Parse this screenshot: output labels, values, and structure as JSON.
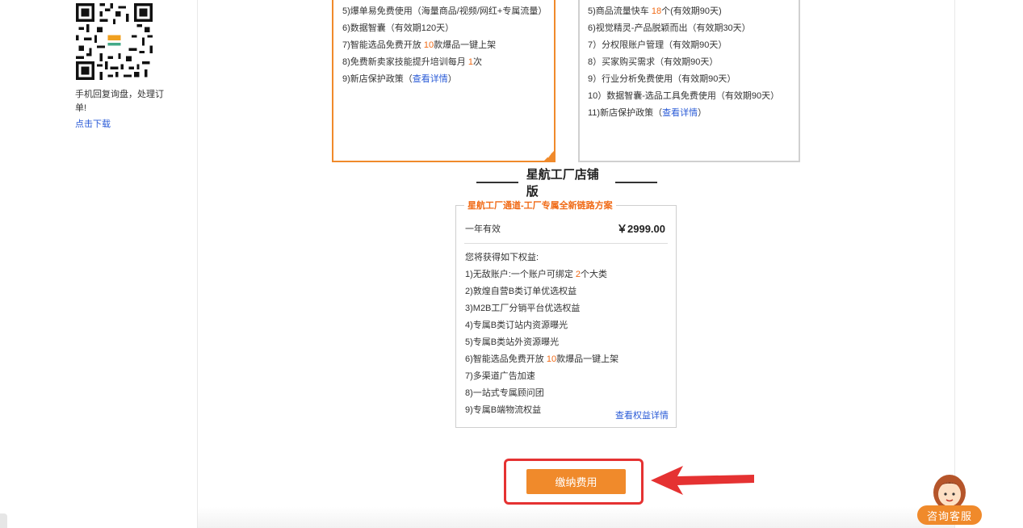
{
  "sidebar": {
    "qr_note": "手机回复询盘，处理订单!",
    "download_link": "点击下载",
    "qr_icon": "qr-code-icon"
  },
  "card_a": {
    "items": [
      {
        "pre": "5)爆单易免费使用（海量商品/视频/网红+专属流量）",
        "hl": "",
        "post": ""
      },
      {
        "pre": "6)数据智囊（有效期120天）",
        "hl": "",
        "post": ""
      },
      {
        "pre": "7)智能选品免费开放 ",
        "hl": "10",
        "post": "款爆品一键上架"
      },
      {
        "pre": "8)免费新卖家技能提升培训每月 ",
        "hl": "1",
        "post": "次"
      },
      {
        "pre": "9)新店保护政策（",
        "link": "查看详情",
        "post": "）"
      }
    ]
  },
  "card_b": {
    "items": [
      {
        "pre": "5)商品流量快车 ",
        "hl": "18",
        "post": "个(有效期90天)"
      },
      {
        "pre": "6)视觉精灵-产品脱颖而出（有效期30天）",
        "hl": "",
        "post": ""
      },
      {
        "pre": "7）分权限账户管理（有效期90天）",
        "hl": "",
        "post": ""
      },
      {
        "pre": "8）买家购买需求（有效期90天）",
        "hl": "",
        "post": ""
      },
      {
        "pre": "9）行业分析免费使用（有效期90天）",
        "hl": "",
        "post": ""
      },
      {
        "pre": "10）数据智囊-选品工具免费使用（有效期90天）",
        "hl": "",
        "post": ""
      },
      {
        "pre": "11)新店保护政策（",
        "link": "查看详情",
        "post": "）"
      }
    ]
  },
  "section_title": "星航工厂店铺版",
  "plan": {
    "legend": "星航工厂通道-工厂专属全新链路方案",
    "validity": "一年有效",
    "price": "￥2999.00",
    "benefits_intro": "您将获得如下权益:",
    "benefits": [
      {
        "pre": "1)无敌账户:一个账户可绑定 ",
        "hl": "2",
        "post": "个大类"
      },
      {
        "pre": "2)敦煌自营B类订单优选权益",
        "hl": "",
        "post": ""
      },
      {
        "pre": "3)M2B工厂分销平台优选权益",
        "hl": "",
        "post": ""
      },
      {
        "pre": "4)专属B类订站内资源曝光",
        "hl": "",
        "post": ""
      },
      {
        "pre": "5)专属B类站外资源曝光",
        "hl": "",
        "post": ""
      },
      {
        "pre": "6)智能选品免费开放 ",
        "hl": "10",
        "post": "款爆品一键上架"
      },
      {
        "pre": "7)多渠道广告加速",
        "hl": "",
        "post": ""
      },
      {
        "pre": "8)一站式专属顾问团",
        "hl": "",
        "post": ""
      },
      {
        "pre": "9)专属B端物流权益",
        "hl": "",
        "post": ""
      }
    ],
    "more_link": "查看权益详情"
  },
  "pay_button": "缴纳费用",
  "customer_service": "咨询客服",
  "colors": {
    "accent": "#f08a2b",
    "highlight": "#f06a16",
    "link": "#2a5bd7",
    "annotation": "#e53232"
  }
}
